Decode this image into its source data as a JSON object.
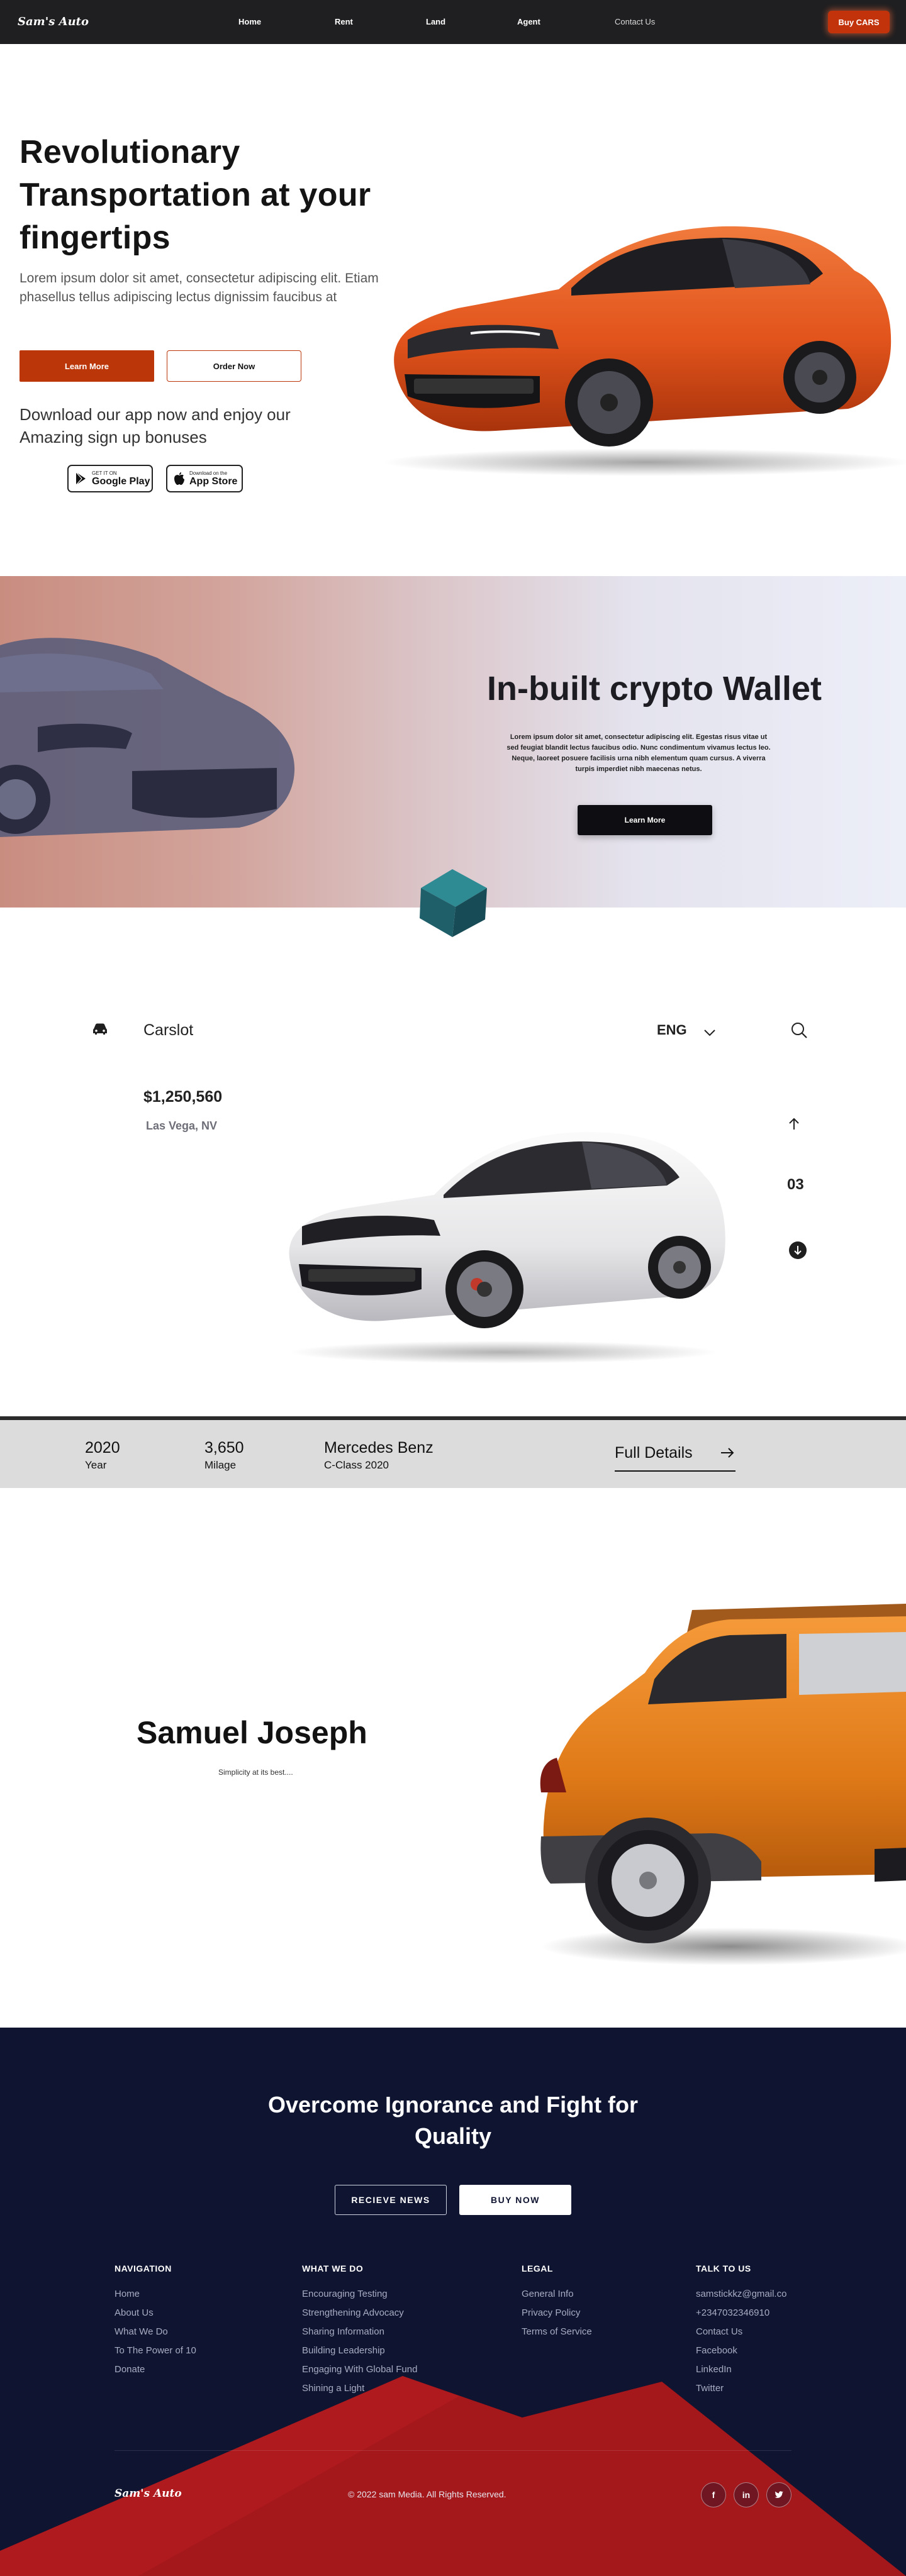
{
  "nav": {
    "brand": "Sam's Auto",
    "links": [
      "Home",
      "Rent",
      "Land",
      "Agent",
      "Contact Us"
    ],
    "cta": "Buy CARS"
  },
  "hero": {
    "title": "Revolutionary Transportation at your fingertips",
    "description": "Lorem ipsum dolor sit amet, consectetur adipiscing elit. Etiam phasellus tellus adipiscing lectus dignissim faucibus at",
    "learn_more": "Learn More",
    "order_now": "Order Now",
    "app_promo": "Download our app now and enjoy our Amazing sign up bonuses",
    "google_play_small": "GET IT ON",
    "google_play_big": "Google Play",
    "app_store_small": "Download on the",
    "app_store_big": "App Store",
    "car_color": "#e2541c"
  },
  "crypto": {
    "title": "In-built crypto Wallet",
    "description": "Lorem ipsum dolor sit amet, consectetur adipiscing elit. Egestas risus vitae ut sed feugiat blandit lectus faucibus odio. Nunc condimentum vivamus lectus leo. Neque, laoreet posuere facilisis urna nibh elementum quam cursus. A viverra turpis imperdiet nibh maecenas netus.",
    "button": "Learn More"
  },
  "carslot": {
    "brand": "Carslot",
    "language": "ENG",
    "price": "$1,250,560",
    "location": "Las Vega, NV",
    "slide_number": "03"
  },
  "specs": {
    "year_value": "2020",
    "year_label": "Year",
    "mileage_value": "3,650",
    "mileage_label": "Milage",
    "model_value": "Mercedes Benz",
    "model_label": "C-Class 2020",
    "details_link": "Full Details"
  },
  "person": {
    "name": "Samuel Joseph",
    "tagline": "Simplicity at its best...."
  },
  "footer": {
    "headline": "Overcome Ignorance and Fight for Quality",
    "btn_news": "RECIEVE NEWS",
    "btn_buy": "BUY NOW",
    "columns": [
      {
        "title": "NAVIGATION",
        "items": [
          "Home",
          "About Us",
          "What We Do",
          "To The Power of 10",
          "Donate"
        ]
      },
      {
        "title": "WHAT WE DO",
        "items": [
          "Encouraging Testing",
          "Strengthening Advocacy",
          "Sharing Information",
          "Building Leadership",
          "Engaging With Global Fund",
          "Shining a Light"
        ]
      },
      {
        "title": "LEGAL",
        "items": [
          "General Info",
          "Privacy Policy",
          "Terms of Service"
        ]
      },
      {
        "title": "TALK TO US",
        "items": [
          "samstickkz@gmail.co",
          "+2347032346910",
          "Contact Us",
          "Facebook",
          "LinkedIn",
          "Twitter"
        ]
      }
    ],
    "brand": "Sam's Auto",
    "copyright": "© 2022 sam Media. All Rights Reserved.",
    "socials": [
      "f",
      "in"
    ],
    "accent": "#a4171b",
    "background": "#0f1431"
  }
}
